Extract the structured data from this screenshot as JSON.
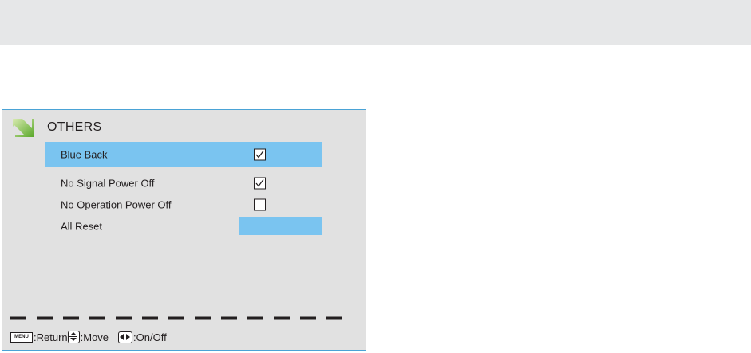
{
  "menu": {
    "title": "OTHERS",
    "items": [
      {
        "label": "Blue Back",
        "checked": true,
        "selected": true
      },
      {
        "label": "No Signal Power Off",
        "checked": true,
        "selected": false
      },
      {
        "label": "No Operation Power Off",
        "checked": false,
        "selected": false
      },
      {
        "label": "All Reset"
      }
    ]
  },
  "hints": {
    "menu_key_label": "MENU",
    "return_label": ":Return",
    "move_label": ":Move",
    "onoff_label": " :On/Off"
  },
  "colors": {
    "panel_bg": "#e1e1e1",
    "highlight": "#7ac4f0",
    "panel_border": "#4aa3d6",
    "title_arrow": "#7cc242"
  }
}
